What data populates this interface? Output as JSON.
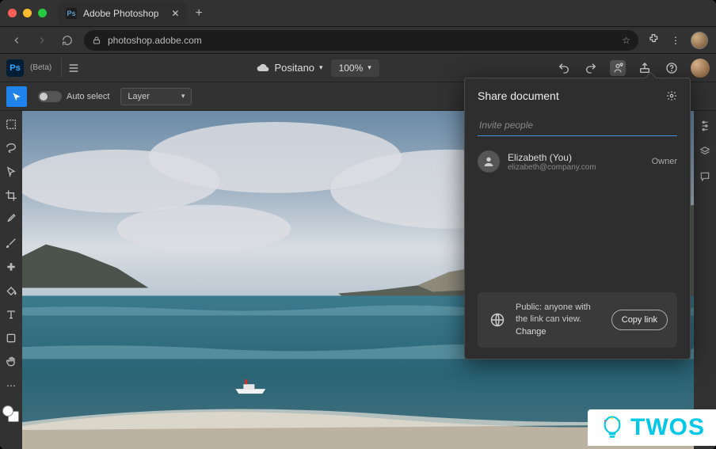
{
  "browser": {
    "tab_title": "Adobe Photoshop",
    "url": "photoshop.adobe.com"
  },
  "appbar": {
    "beta_label": "(Beta)",
    "doc_name": "Positano",
    "zoom": "100%"
  },
  "optbar": {
    "auto_select_label": "Auto select",
    "layer_dropdown": "Layer"
  },
  "share": {
    "title": "Share document",
    "invite_placeholder": "Invite people",
    "person_name": "Elizabeth (You)",
    "person_email": "elizabeth@company.com",
    "role": "Owner",
    "link_text_prefix": "Public: anyone with the link can view. ",
    "link_change": "Change",
    "copy_btn": "Copy link"
  },
  "watermark": {
    "text": "TWOS"
  }
}
